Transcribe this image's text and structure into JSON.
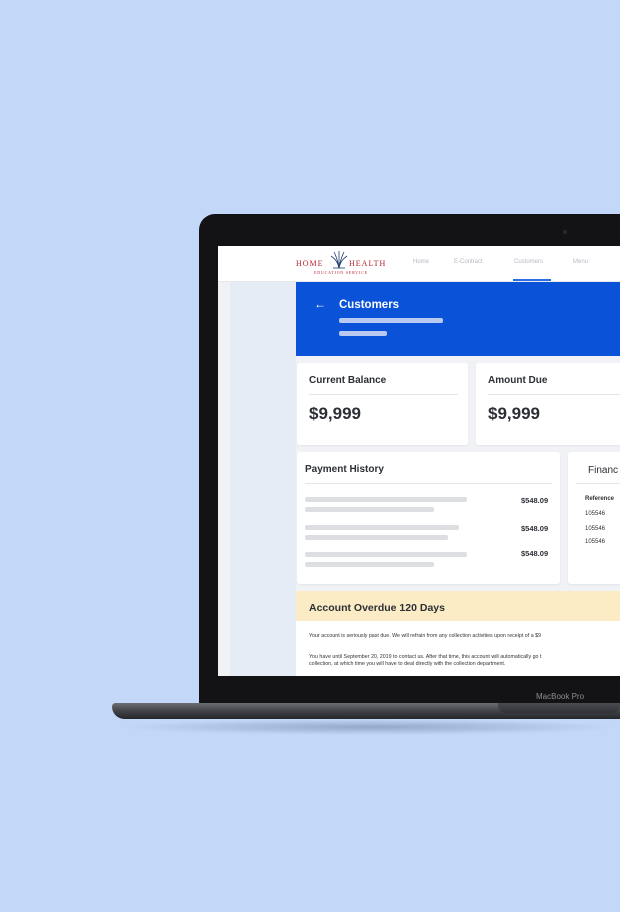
{
  "device": {
    "bezel_label": "MacBook Pro"
  },
  "app": {
    "logo": {
      "left": "Home",
      "right": "Health",
      "sub": "Education Service"
    },
    "nav": [
      {
        "label": "Home"
      },
      {
        "label": "E-Contract"
      },
      {
        "label": "Customers",
        "active": true
      },
      {
        "label": "Menu"
      }
    ],
    "header": {
      "title": "Customers",
      "back_icon": "arrow-left-icon"
    },
    "current_balance": {
      "title": "Current Balance",
      "value": "$9,999"
    },
    "amount_due": {
      "title": "Amount Due",
      "value": "$9,999"
    },
    "payment_history": {
      "title": "Payment History",
      "rows": [
        {
          "amount": "$548.09"
        },
        {
          "amount": "$548.09"
        },
        {
          "amount": "$548.09"
        }
      ]
    },
    "financials": {
      "title": "Financ",
      "header": "Reference",
      "rows": [
        {
          "ref": "105546"
        },
        {
          "ref": "105546"
        },
        {
          "ref": "105546"
        }
      ]
    },
    "overdue": {
      "title": "Account Overdue 120 Days",
      "line1": "Your account is seriously past due. We will refrain from any collection activities upon receipt of a $9",
      "line2": "You have until September 20, 2019 to contact us. After that time, this account will automatically go t",
      "line3": "collection, at which time you will have to deal directly with the collection department."
    }
  },
  "colors": {
    "background": "#c3d7f8",
    "accent": "#0a52d8",
    "warning_band": "#fbecc5",
    "brand": "#b2232f"
  }
}
